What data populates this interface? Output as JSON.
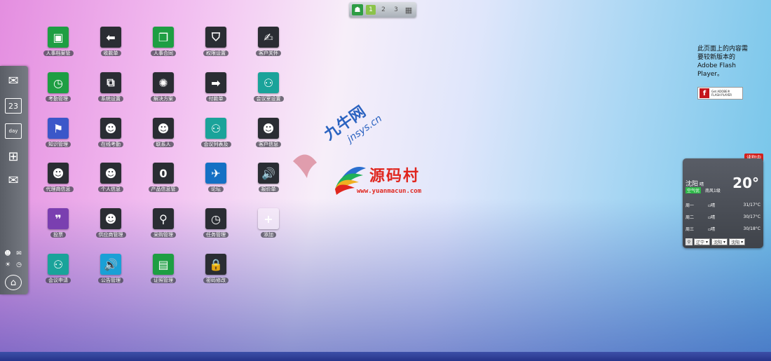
{
  "pager": {
    "pages": [
      "1",
      "2",
      "3"
    ],
    "active_page": "1"
  },
  "dock": {
    "icons": [
      "mail-icon",
      "calendar-icon",
      "day-icon",
      "widget-add-icon",
      "mail-alt-icon"
    ],
    "calendar_number": "23",
    "day_label": "day"
  },
  "apps": [
    {
      "label": "人事档案管",
      "color": "#1e9e43",
      "icon": "contacts-icon",
      "glyph": "▣"
    },
    {
      "label": "收款单",
      "color": "#2a2d33",
      "icon": "arrow-left-icon",
      "glyph": "⬅"
    },
    {
      "label": "人事合同",
      "color": "#1e9e43",
      "icon": "windows-icon",
      "glyph": "❐"
    },
    {
      "label": "权限设置",
      "color": "#2a2d33",
      "icon": "shield-icon",
      "glyph": "⛉"
    },
    {
      "label": "客户关怀",
      "color": "#2a2d33",
      "icon": "user-pen-icon",
      "glyph": "✍"
    },
    {
      "label": "考勤管理",
      "color": "#1e9e43",
      "icon": "clock-icon",
      "glyph": "◷"
    },
    {
      "label": "系统设置",
      "color": "#2a2d33",
      "icon": "settings-icon",
      "glyph": "⧉"
    },
    {
      "label": "解决方案",
      "color": "#2a2d33",
      "icon": "aperture-icon",
      "glyph": "✺"
    },
    {
      "label": "付款单",
      "color": "#2a2d33",
      "icon": "arrow-right-icon",
      "glyph": "➡"
    },
    {
      "label": "会议室设置",
      "color": "#1aa39a",
      "icon": "meeting-icon",
      "glyph": "⚇"
    },
    {
      "label": "知识管理",
      "color": "#3b57c9",
      "icon": "knowledge-icon",
      "glyph": "⚑"
    },
    {
      "label": "在线考勤",
      "color": "#2a2d33",
      "icon": "user-icon",
      "glyph": "☻"
    },
    {
      "label": "联系人",
      "color": "#2a2d33",
      "icon": "users-icon",
      "glyph": "☻"
    },
    {
      "label": "会议列表及",
      "color": "#1aa39a",
      "icon": "meeting-list-icon",
      "glyph": "⚇"
    },
    {
      "label": "客户信息",
      "color": "#2a2d33",
      "icon": "user-add-icon",
      "glyph": "☻"
    },
    {
      "label": "代理商信息",
      "color": "#2a2d33",
      "icon": "agent-icon",
      "glyph": "☻"
    },
    {
      "label": "个人信息",
      "color": "#2a2d33",
      "icon": "profile-icon",
      "glyph": "☻"
    },
    {
      "label": "产品信息管",
      "color": "#2a2d33",
      "icon": "product-icon",
      "glyph": "0"
    },
    {
      "label": "论坛",
      "color": "#1570c4",
      "icon": "forum-icon",
      "glyph": "✈"
    },
    {
      "label": "报价单",
      "color": "#2a2d33",
      "icon": "speaker-icon",
      "glyph": "🔊"
    },
    {
      "label": "投票",
      "color": "#7a3fb0",
      "icon": "vote-icon",
      "glyph": "❞"
    },
    {
      "label": "供应商管理",
      "color": "#2a2d33",
      "icon": "supplier-icon",
      "glyph": "☻"
    },
    {
      "label": "采购管理",
      "color": "#2a2d33",
      "icon": "search-icon",
      "glyph": "⚲"
    },
    {
      "label": "任务管理",
      "color": "#2a2d33",
      "icon": "task-clock-icon",
      "glyph": "◷"
    },
    {
      "label": "添加",
      "color": "rgba(255,255,255,0.35)",
      "icon": "add-icon",
      "glyph": "+"
    },
    {
      "label": "会议申请",
      "color": "#1aa39a",
      "icon": "meeting-request-icon",
      "glyph": "⚇"
    },
    {
      "label": "公告管理",
      "color": "#1aa0d6",
      "icon": "announce-icon",
      "glyph": "🔊"
    },
    {
      "label": "证照管理",
      "color": "#1e9e43",
      "icon": "certificate-icon",
      "glyph": "▤"
    },
    {
      "label": "密码修改",
      "color": "#2a2d33",
      "icon": "lock-icon",
      "glyph": "🔒"
    }
  ],
  "flash": {
    "message": "此页面上的内容需要较新版本的 Adobe Flash Player。",
    "button_line1": "Get ADOBE®",
    "button_line2": "FLASH PLAYER"
  },
  "weather": {
    "loading": "读取中",
    "city": "沈阳",
    "condition": "晴",
    "air_quality": "空气优",
    "wind": "南风1级",
    "temperature": "20°",
    "forecast": [
      {
        "day": "周一",
        "cond": "晴",
        "range": "31/17°C"
      },
      {
        "day": "周二",
        "cond": "晴",
        "range": "30/17°C"
      },
      {
        "day": "周三",
        "cond": "晴",
        "range": "30/18°C"
      }
    ],
    "province": "辽宁",
    "city_select": "沈阳",
    "district_select": "沈阳"
  },
  "watermark": {
    "brand1": "九牛网",
    "brand1_domain": "jnsys.cn",
    "brand2": "源码村",
    "brand2_domain": "www.yuanmacun.com"
  }
}
